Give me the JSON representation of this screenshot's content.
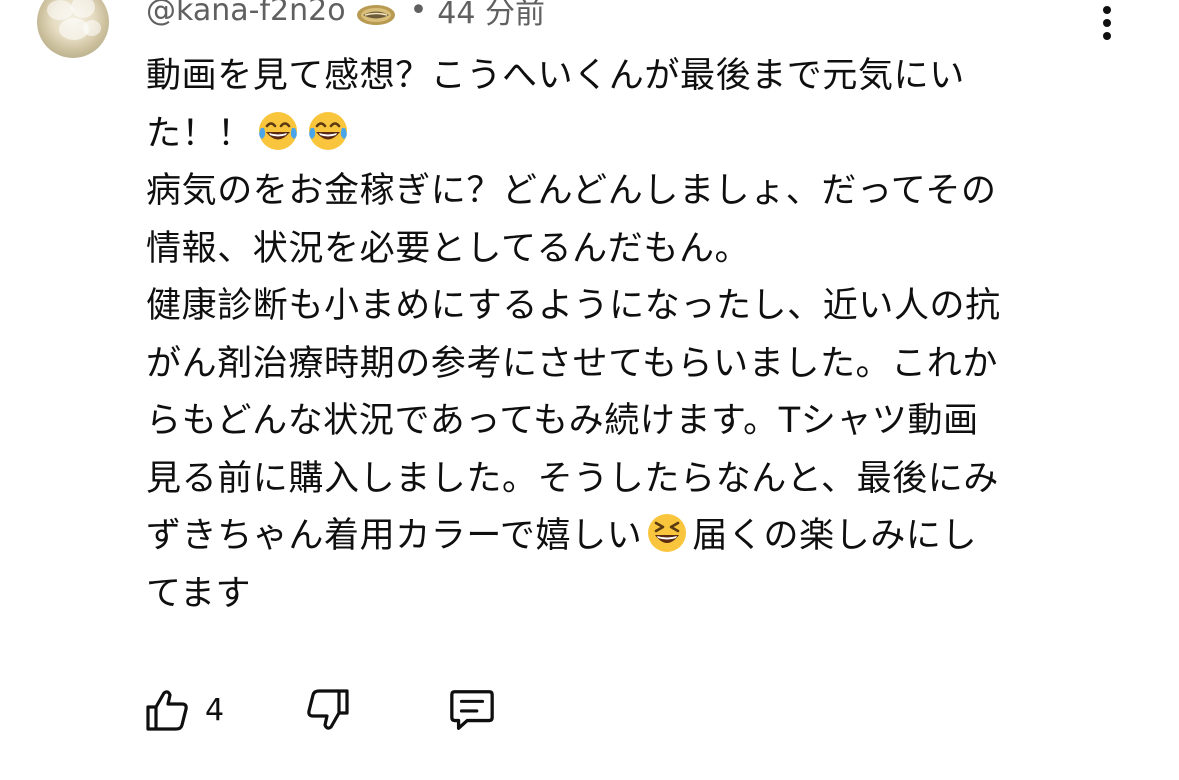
{
  "comment": {
    "author": "@kana-f2n2o",
    "separator": "•",
    "time": "44 分前",
    "lines": [
      "動画を見て感想？こうへいくんが最後まで元気にい",
      "た！！",
      "病気のをお金稼ぎに？どんどんしましょ、だってその",
      "情報、状況を必要としてるんだもん。",
      "健康診断も小まめにするようになったし、近い人の抗",
      "がん剤治療時期の参考にさせてもらいました。これか",
      "らもどんな状況であってもみ続けます。Tシャツ動画",
      "見る前に購入しました。そうしたらなんと、最後にみ",
      "ずきちゃん着用カラーで嬉しい",
      "届くの楽しみにし",
      "てます"
    ],
    "emojis": [
      "tears-of-joy-emoji",
      "tears-of-joy-emoji",
      "grinning-squinting-emoji"
    ],
    "like_count": "4"
  },
  "icons": {
    "avatar": "flower-avatar",
    "badge": "lips-badge-icon",
    "menu": "more-vert-icon",
    "like": "thumbs-up-icon",
    "dislike": "thumbs-down-icon",
    "reply": "reply-icon"
  },
  "colors": {
    "text": "#0f0f0f",
    "secondary_text": "#606060",
    "emoji_face": "#f9c53c",
    "emoji_tear": "#4aa5e8"
  }
}
